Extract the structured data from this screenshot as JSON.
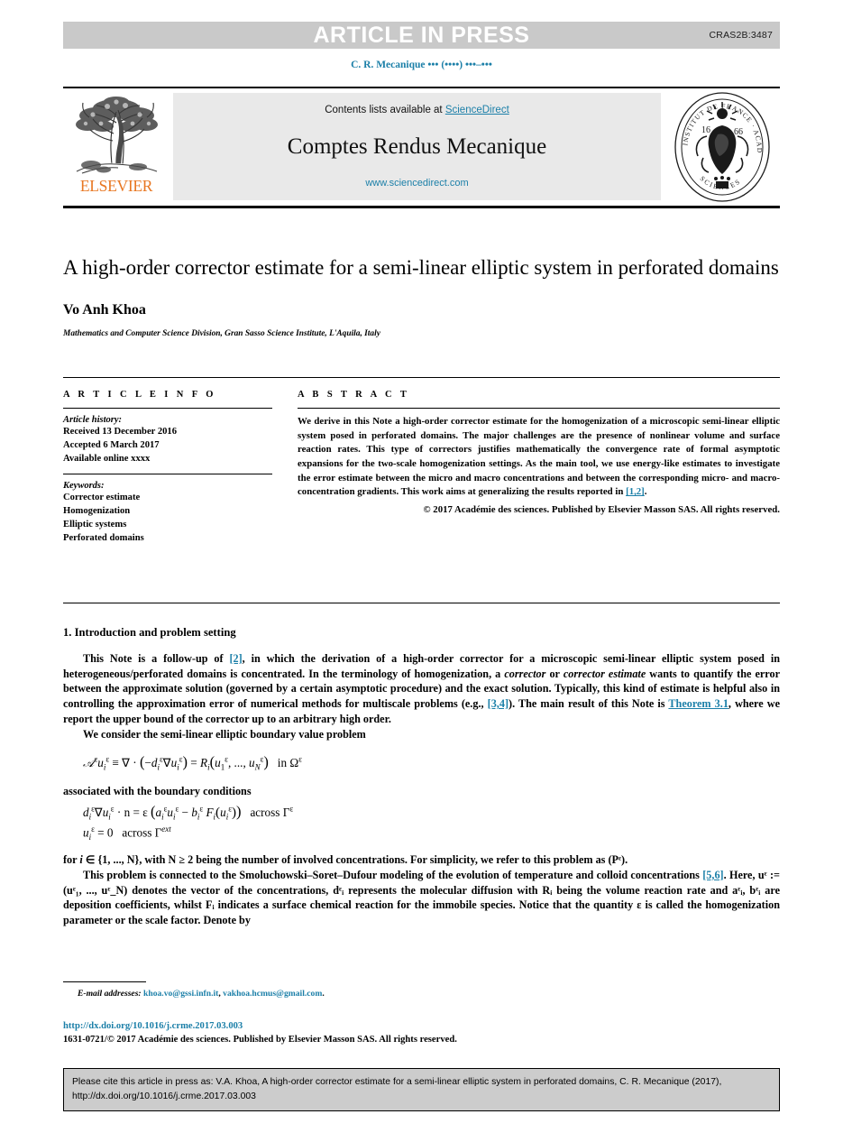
{
  "banner": {
    "press_text": "ARTICLE IN PRESS",
    "press_code": "CRAS2B:3487"
  },
  "running_head": "C. R. Mecanique ••• (••••) •••–•••",
  "masthead": {
    "publisher_wordmark": "ELSEVIER",
    "contents_prefix": "Contents lists available at ",
    "contents_link": "ScienceDirect",
    "journal_title": "Comptes Rendus Mecanique",
    "journal_url": "www.sciencedirect.com"
  },
  "article": {
    "title": "A high-order corrector estimate for a semi-linear elliptic system in perforated domains",
    "author": "Vo Anh Khoa",
    "affiliation": "Mathematics and Computer Science Division, Gran Sasso Science Institute, L'Aquila, Italy"
  },
  "info": {
    "heading": "A R T I C L E    I N F O",
    "history_label": "Article history:",
    "history": [
      "Received 13 December 2016",
      "Accepted 6 March 2017",
      "Available online xxxx"
    ],
    "keywords_label": "Keywords:",
    "keywords": [
      "Corrector estimate",
      "Homogenization",
      "Elliptic systems",
      "Perforated domains"
    ]
  },
  "abstract": {
    "heading": "A B S T R A C T",
    "part1": "We derive in this Note a high-order corrector estimate for the homogenization of a microscopic semi-linear elliptic system posed in perforated domains. The major challenges are the presence of nonlinear volume and surface reaction rates. This type of correctors justifies mathematically the convergence rate of formal asymptotic expansions for the two-scale homogenization settings. As the main tool, we use energy-like estimates to investigate the error estimate between the micro and macro concentrations and between the corresponding micro- and macro-concentration gradients. This work aims at generalizing the results reported in ",
    "ref_link": "[1,2]",
    "part2": ".",
    "copyright": "© 2017 Académie des sciences. Published by Elsevier Masson SAS. All rights reserved."
  },
  "body": {
    "section_title": "1. Introduction and problem setting",
    "p1_a": "This Note is a follow-up of ",
    "p1_ref1": "[2]",
    "p1_b": ", in which the derivation of a high-order corrector for a microscopic semi-linear elliptic system posed in heterogeneous/perforated domains is concentrated. In the terminology of homogenization, a ",
    "p1_it1": "corrector",
    "p1_c": " or ",
    "p1_it2": "corrector estimate",
    "p1_d": " wants to quantify the error between the approximate solution (governed by a certain asymptotic procedure) and the exact solution. Typically, this kind of estimate is helpful also in controlling the approximation error of numerical methods for multiscale problems (e.g., ",
    "p1_ref2": "[3,4]",
    "p1_e": "). The main result of this Note is ",
    "p1_ref3": "Theorem 3.1",
    "p1_f": ", where we report the upper bound of the corrector up to an arbitrary high order.",
    "p2": "We consider the semi-linear elliptic boundary value problem",
    "eq1": "𝒜ᵋuᵋ ≡ ∇ · (−dᵋ∇uᵋ) = Rᵢ(uᵋ₁, ..., uᵋ_N)   in Ωᵋ",
    "p3": "associated with the boundary conditions",
    "eq2": "dᵋ∇uᵋ · n = ε(aᵋuᵋ − bᵋFᵢ(uᵋ))   across Γᵋ",
    "eq3": "uᵋ = 0   across Γ^ext",
    "p4_a": "for ",
    "p4_it1": "i",
    "p4_b": " ∈ {1, ..., N}, with N ≥ 2 being the number of involved concentrations. For simplicity, we refer to this problem as (Pᵋ).",
    "p5_a": "This problem is connected to the Smoluchowski–Soret–Dufour modeling of the evolution of temperature and colloid concentrations ",
    "p5_ref": "[5,6]",
    "p5_b": ". Here, uᵋ := (uᵋ₁, ..., uᵋ_N) denotes the vector of the concentrations, dᵋᵢ represents the molecular diffusion with Rᵢ being the volume reaction rate and aᵋᵢ, bᵋᵢ are deposition coefficients, whilst Fᵢ indicates a surface chemical reaction for the immobile species. Notice that the quantity ε is called the homogenization parameter or the scale factor. Denote by"
  },
  "footer": {
    "email_label": "E-mail addresses:",
    "email1": "khoa.vo@gssi.infn.it",
    "email_sep": ", ",
    "email2": "vakhoa.hcmus@gmail.com",
    "email_end": ".",
    "doi": "http://dx.doi.org/10.1016/j.crme.2017.03.003",
    "issn": "1631-0721/© 2017 Académie des sciences. Published by Elsevier Masson SAS. All rights reserved.",
    "cite_text": "Please cite this article in press as: V.A. Khoa, A high-order corrector estimate for a semi-linear elliptic system in perforated domains, C. R. Mecanique (2017), http://dx.doi.org/10.1016/j.crme.2017.03.003"
  },
  "colors": {
    "link": "#1b7fa8",
    "banner_bg": "#c9c9c9",
    "masthead_bg": "#e9e9e9",
    "elsevier_orange": "#e87722",
    "cite_bg": "#cccccc"
  }
}
